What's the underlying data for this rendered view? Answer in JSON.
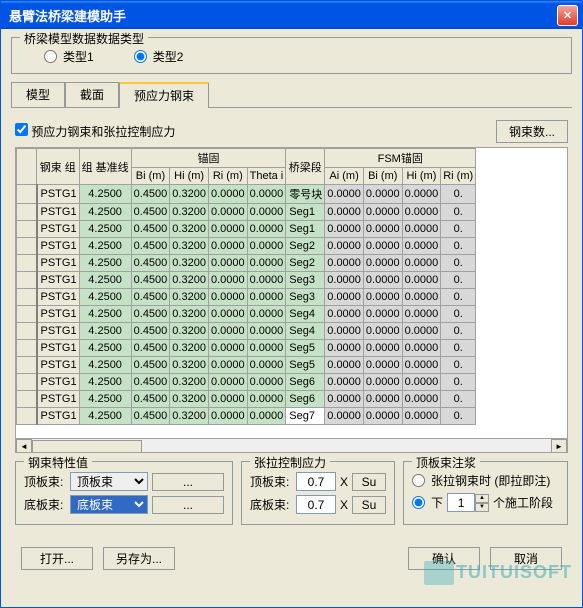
{
  "window": {
    "title": "悬臂法桥梁建模助手"
  },
  "model_type": {
    "legend": "桥梁模型数据数据类型",
    "opt1": "类型1",
    "opt2": "类型2"
  },
  "tabs": {
    "model": "模型",
    "section": "截面",
    "prestress": "预应力钢束"
  },
  "check_label": "预应力钢束和张拉控制应力",
  "tendon_count_btn": "钢束数...",
  "table": {
    "headers": {
      "group": "钢束\n组",
      "baseline": "组\n基准线",
      "anchor": "锚固",
      "bi": "Bi\n(m)",
      "hi": "Hi\n(m)",
      "ri": "Ri\n(m)",
      "theta": "Theta\ni",
      "segment": "桥梁段",
      "fsm": "FSM锚固",
      "ai": "Ai\n(m)",
      "bi2": "Bi\n(m)",
      "hi2": "Hi\n(m)",
      "ri2": "Ri\n(m)"
    },
    "rows": [
      {
        "name": "PSTG1",
        "base": "4.2500",
        "bi": "0.4500",
        "hi": "0.3200",
        "ri": "0.0000",
        "th": "0.0000",
        "seg": "零号块",
        "ai": "0.0000",
        "bi2": "0.0000",
        "hi2": "0.0000",
        "ri2": "0."
      },
      {
        "name": "PSTG1",
        "base": "4.2500",
        "bi": "0.4500",
        "hi": "0.3200",
        "ri": "0.0000",
        "th": "0.0000",
        "seg": "Seg1",
        "ai": "0.0000",
        "bi2": "0.0000",
        "hi2": "0.0000",
        "ri2": "0."
      },
      {
        "name": "PSTG1",
        "base": "4.2500",
        "bi": "0.4500",
        "hi": "0.3200",
        "ri": "0.0000",
        "th": "0.0000",
        "seg": "Seg1",
        "ai": "0.0000",
        "bi2": "0.0000",
        "hi2": "0.0000",
        "ri2": "0."
      },
      {
        "name": "PSTG1",
        "base": "4.2500",
        "bi": "0.4500",
        "hi": "0.3200",
        "ri": "0.0000",
        "th": "0.0000",
        "seg": "Seg2",
        "ai": "0.0000",
        "bi2": "0.0000",
        "hi2": "0.0000",
        "ri2": "0."
      },
      {
        "name": "PSTG1",
        "base": "4.2500",
        "bi": "0.4500",
        "hi": "0.3200",
        "ri": "0.0000",
        "th": "0.0000",
        "seg": "Seg2",
        "ai": "0.0000",
        "bi2": "0.0000",
        "hi2": "0.0000",
        "ri2": "0."
      },
      {
        "name": "PSTG1",
        "base": "4.2500",
        "bi": "0.4500",
        "hi": "0.3200",
        "ri": "0.0000",
        "th": "0.0000",
        "seg": "Seg3",
        "ai": "0.0000",
        "bi2": "0.0000",
        "hi2": "0.0000",
        "ri2": "0."
      },
      {
        "name": "PSTG1",
        "base": "4.2500",
        "bi": "0.4500",
        "hi": "0.3200",
        "ri": "0.0000",
        "th": "0.0000",
        "seg": "Seg3",
        "ai": "0.0000",
        "bi2": "0.0000",
        "hi2": "0.0000",
        "ri2": "0."
      },
      {
        "name": "PSTG1",
        "base": "4.2500",
        "bi": "0.4500",
        "hi": "0.3200",
        "ri": "0.0000",
        "th": "0.0000",
        "seg": "Seg4",
        "ai": "0.0000",
        "bi2": "0.0000",
        "hi2": "0.0000",
        "ri2": "0."
      },
      {
        "name": "PSTG1",
        "base": "4.2500",
        "bi": "0.4500",
        "hi": "0.3200",
        "ri": "0.0000",
        "th": "0.0000",
        "seg": "Seg4",
        "ai": "0.0000",
        "bi2": "0.0000",
        "hi2": "0.0000",
        "ri2": "0."
      },
      {
        "name": "PSTG1",
        "base": "4.2500",
        "bi": "0.4500",
        "hi": "0.3200",
        "ri": "0.0000",
        "th": "0.0000",
        "seg": "Seg5",
        "ai": "0.0000",
        "bi2": "0.0000",
        "hi2": "0.0000",
        "ri2": "0."
      },
      {
        "name": "PSTG1",
        "base": "4.2500",
        "bi": "0.4500",
        "hi": "0.3200",
        "ri": "0.0000",
        "th": "0.0000",
        "seg": "Seg5",
        "ai": "0.0000",
        "bi2": "0.0000",
        "hi2": "0.0000",
        "ri2": "0."
      },
      {
        "name": "PSTG1",
        "base": "4.2500",
        "bi": "0.4500",
        "hi": "0.3200",
        "ri": "0.0000",
        "th": "0.0000",
        "seg": "Seg6",
        "ai": "0.0000",
        "bi2": "0.0000",
        "hi2": "0.0000",
        "ri2": "0."
      },
      {
        "name": "PSTG1",
        "base": "4.2500",
        "bi": "0.4500",
        "hi": "0.3200",
        "ri": "0.0000",
        "th": "0.0000",
        "seg": "Seg6",
        "ai": "0.0000",
        "bi2": "0.0000",
        "hi2": "0.0000",
        "ri2": "0."
      },
      {
        "name": "PSTG1",
        "base": "4.2500",
        "bi": "0.4500",
        "hi": "0.3200",
        "ri": "0.0000",
        "th": "0.0000",
        "seg": "Seg7",
        "ai": "0.0000",
        "bi2": "0.0000",
        "hi2": "0.0000",
        "ri2": "0."
      }
    ]
  },
  "tendon_props": {
    "legend": "钢束特性值",
    "top_label": "顶板束:",
    "top_value": "顶板束",
    "bottom_label": "底板束:",
    "bottom_value": "底板束"
  },
  "tension": {
    "legend": "张拉控制应力",
    "top_label": "顶板束:",
    "top_value": "0.7",
    "x": "X",
    "su": "Su",
    "bottom_label": "底板束:",
    "bottom_value": "0.7"
  },
  "grout": {
    "legend": "顶板束注浆",
    "opt1": "张拉钢束时 (即拉即注)",
    "opt2_pre": "下",
    "opt2_val": "1",
    "opt2_suf": "个施工阶段"
  },
  "footer": {
    "open": "打开...",
    "saveas": "另存为...",
    "ok": "确认",
    "cancel": "取消"
  },
  "dots": "...",
  "watermark": "TUITUISOFT"
}
